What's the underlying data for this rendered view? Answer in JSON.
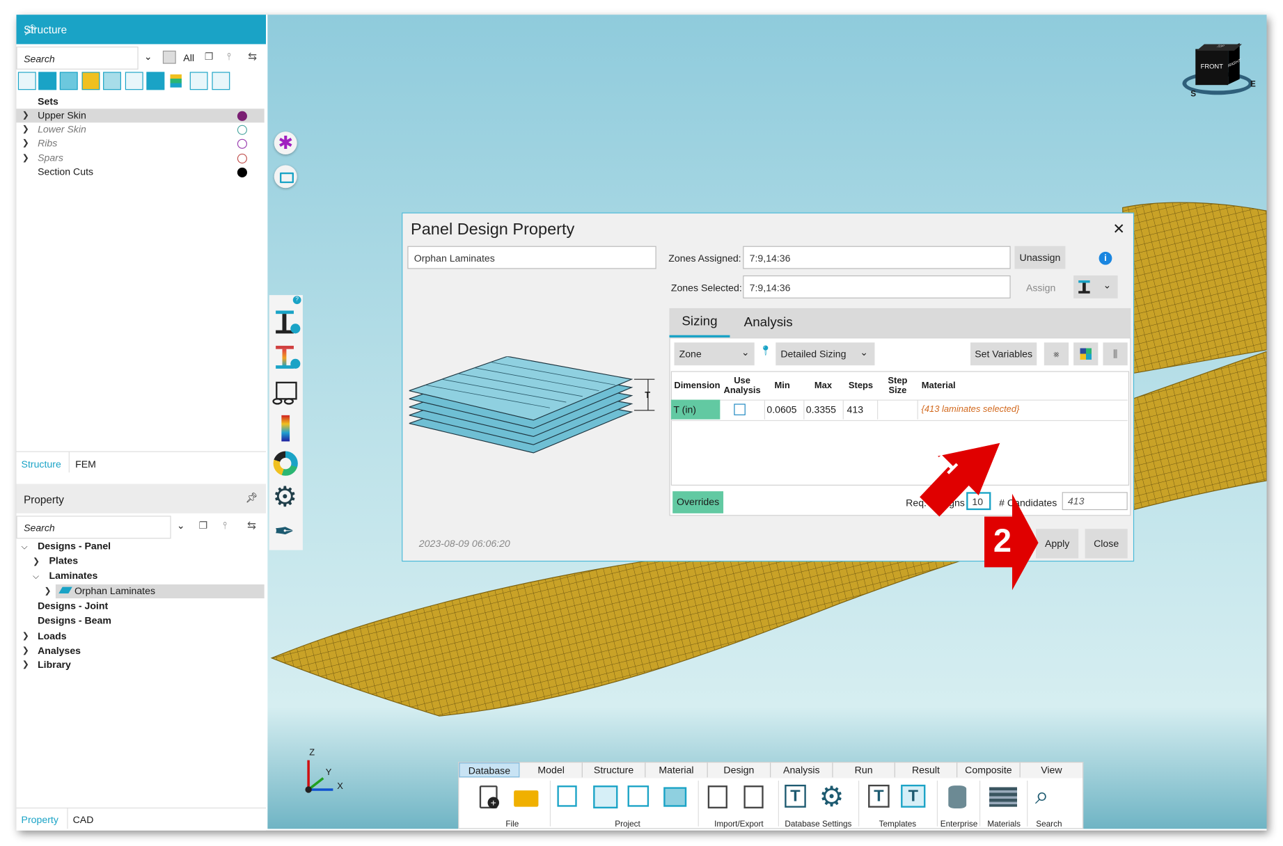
{
  "structure_panel": {
    "title": "Structure",
    "search_placeholder": "Search",
    "all_label": "All",
    "tree": [
      {
        "label": "Sets",
        "bold": true
      },
      {
        "label": "Upper Skin",
        "dot_color": "#7a1f73",
        "filled": true,
        "selected": true
      },
      {
        "label": "Lower Skin",
        "dot_color": "#4aa6a0",
        "filled": false
      },
      {
        "label": "Ribs",
        "dot_color": "#9b3fb0",
        "filled": false
      },
      {
        "label": "Spars",
        "dot_color": "#c0504d",
        "filled": false
      },
      {
        "label": "Section Cuts",
        "dot_color": "#000000",
        "filled": true
      }
    ],
    "tabs": [
      "Structure",
      "FEM"
    ]
  },
  "property_panel": {
    "title": "Property",
    "search_placeholder": "Search",
    "tree": {
      "designs_panel": "Designs - Panel",
      "plates": "Plates",
      "laminates": "Laminates",
      "orphan_laminates": "Orphan Laminates",
      "designs_joint": "Designs - Joint",
      "designs_beam": "Designs - Beam",
      "loads": "Loads",
      "analyses": "Analyses",
      "library": "Library"
    },
    "tabs": [
      "Property",
      "CAD"
    ]
  },
  "viewcube": {
    "front": "FRONT",
    "right": "RIGHT",
    "top": "TOP",
    "s": "S",
    "e": "E"
  },
  "axes": {
    "z": "Z",
    "y": "Y",
    "x": "X"
  },
  "dialog": {
    "title": "Panel Design Property",
    "name_value": "Orphan Laminates",
    "zones_assigned_label": "Zones Assigned:",
    "zones_assigned_value": "7:9,14:36",
    "zones_selected_label": "Zones Selected:",
    "zones_selected_value": "7:9,14:36",
    "unassign_label": "Unassign",
    "assign_label": "Assign",
    "thickness_label": "T",
    "tabs": [
      "Sizing",
      "Analysis"
    ],
    "zone_dropdown": "Zone",
    "sizing_dropdown": "Detailed Sizing",
    "set_variables_label": "Set Variables",
    "columns": {
      "dimension": "Dimension",
      "use": "Use",
      "analysis": "Analysis",
      "min": "Min",
      "max": "Max",
      "steps": "Steps",
      "step": "Step",
      "size": "Size",
      "material": "Material"
    },
    "row": {
      "dimension": "T (in)",
      "use_analysis": false,
      "min": "0.0605",
      "max": "0.3355",
      "steps": "413",
      "step_size": "",
      "material": "{413 laminates selected}"
    },
    "overrides_label": "Overrides",
    "req_designs_label": "Req. Designs",
    "req_designs_value": "10",
    "candidates_label": "# Candidates",
    "candidates_value": "413",
    "timestamp": "2023-08-09 06:06:20",
    "apply_label": "Apply",
    "close_label": "Close"
  },
  "annotations": {
    "step1": "1",
    "step2": "2"
  },
  "ribbon": {
    "tabs": [
      "Database",
      "Model",
      "Structure",
      "Material",
      "Design",
      "Analysis",
      "Run",
      "Result",
      "Composite",
      "View"
    ],
    "active_tab": "Database",
    "groups": [
      "File",
      "Project",
      "Import/Export",
      "Database Settings",
      "Templates",
      "Enterprise",
      "Materials",
      "Search"
    ]
  },
  "colors": {
    "accent": "#1aa3c6",
    "overrides_green": "#62c9a2",
    "wing_mesh": "#c9a227",
    "annotation_red": "#e00000",
    "material_text": "#d2691e"
  }
}
